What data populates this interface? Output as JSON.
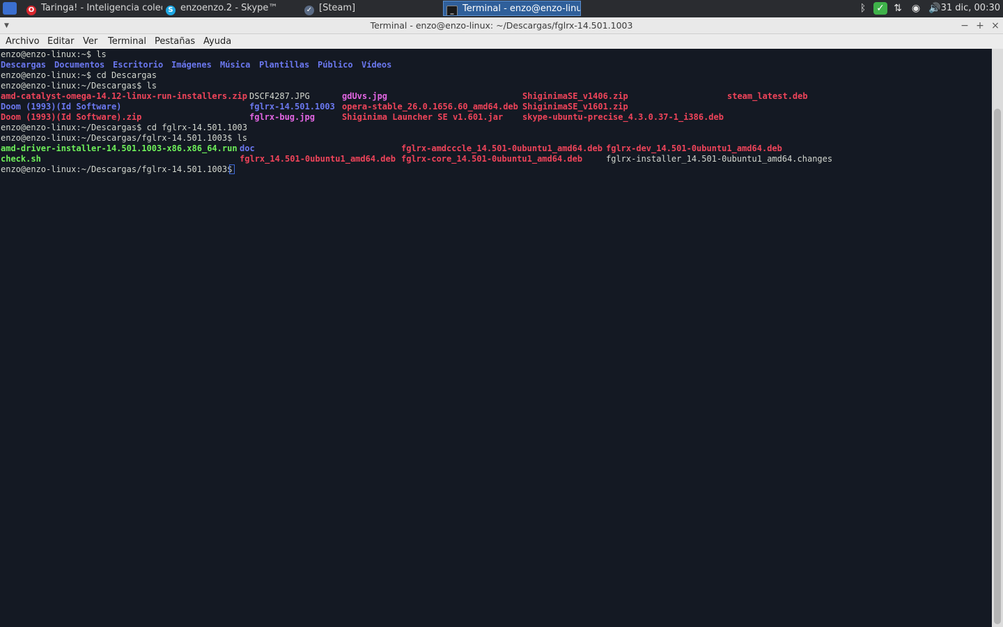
{
  "panel": {
    "tasks": [
      {
        "label": "Taringa! - Inteligencia colec...",
        "icon": "opera-icon"
      },
      {
        "label": "enzoenzo.2 - Skype™",
        "icon": "skype-icon"
      },
      {
        "label": "[Steam]",
        "icon": "steam-icon"
      },
      {
        "label": "Terminal - enzo@enzo-linu...",
        "icon": "terminal-icon"
      }
    ],
    "clock": "31 dic, 00:30"
  },
  "window": {
    "title": "Terminal - enzo@enzo-linux: ~/Descargas/fglrx-14.501.1003",
    "menu": [
      "Archivo",
      "Editar",
      "Ver",
      "Terminal",
      "Pestañas",
      "Ayuda"
    ]
  },
  "terminal": {
    "lines": [
      [
        {
          "t": "enzo@enzo-linux:~$ ls",
          "c": "plain"
        }
      ],
      [
        {
          "t": "Descargas",
          "c": "dir"
        },
        {
          "t": "Documentos",
          "c": "dir"
        },
        {
          "t": "Escritorio",
          "c": "dir"
        },
        {
          "t": "Imágenes",
          "c": "dir"
        },
        {
          "t": "Música",
          "c": "dir"
        },
        {
          "t": "Plantillas",
          "c": "dir"
        },
        {
          "t": "Público",
          "c": "dir"
        },
        {
          "t": "Vídeos",
          "c": "dir"
        }
      ],
      [
        {
          "t": "enzo@enzo-linux:~$ cd Descargas",
          "c": "plain"
        }
      ],
      [
        {
          "t": "enzo@enzo-linux:~/Descargas$ ls",
          "c": "plain"
        }
      ],
      [
        {
          "t": "amd-catalyst-omega-14.12-linux-run-installers.zip",
          "c": "arc"
        },
        {
          "t": "DSCF4287.JPG",
          "c": "plain"
        },
        {
          "t": "gdUvs.jpg",
          "c": "img"
        },
        {
          "t": "ShiginimaSE_v1406.zip",
          "c": "arc"
        },
        {
          "t": "steam_latest.deb",
          "c": "arc"
        }
      ],
      [
        {
          "t": "Doom (1993)(Id Software)",
          "c": "dir"
        },
        {
          "t": "fglrx-14.501.1003",
          "c": "dir"
        },
        {
          "t": "opera-stable_26.0.1656.60_amd64.deb",
          "c": "arc"
        },
        {
          "t": "ShiginimaSE_v1601.zip",
          "c": "arc"
        }
      ],
      [
        {
          "t": "Doom (1993)(Id Software).zip",
          "c": "arc"
        },
        {
          "t": "fglrx-bug.jpg",
          "c": "img"
        },
        {
          "t": "Shiginima Launcher SE v1.601.jar",
          "c": "arc"
        },
        {
          "t": "skype-ubuntu-precise_4.3.0.37-1_i386.deb",
          "c": "arc"
        }
      ],
      [
        {
          "t": "enzo@enzo-linux:~/Descargas$ cd fglrx-14.501.1003",
          "c": "plain"
        }
      ],
      [
        {
          "t": "enzo@enzo-linux:~/Descargas/fglrx-14.501.1003$ ls",
          "c": "plain"
        }
      ],
      [
        {
          "t": "amd-driver-installer-14.501.1003-x86.x86_64.run",
          "c": "exe"
        },
        {
          "t": "doc",
          "c": "dir"
        },
        {
          "t": "fglrx-amdcccle_14.501-0ubuntu1_amd64.deb",
          "c": "arc"
        },
        {
          "t": "fglrx-dev_14.501-0ubuntu1_amd64.deb",
          "c": "arc"
        }
      ],
      [
        {
          "t": "check.sh",
          "c": "exe"
        },
        {
          "t": "fglrx_14.501-0ubuntu1_amd64.deb",
          "c": "arc"
        },
        {
          "t": "fglrx-core_14.501-0ubuntu1_amd64.deb",
          "c": "arc"
        },
        {
          "t": "fglrx-installer_14.501-0ubuntu1_amd64.changes",
          "c": "plain"
        }
      ],
      [
        {
          "t": "enzo@enzo-linux:~/Descargas/fglrx-14.501.1003$ ",
          "c": "plain"
        }
      ]
    ]
  }
}
